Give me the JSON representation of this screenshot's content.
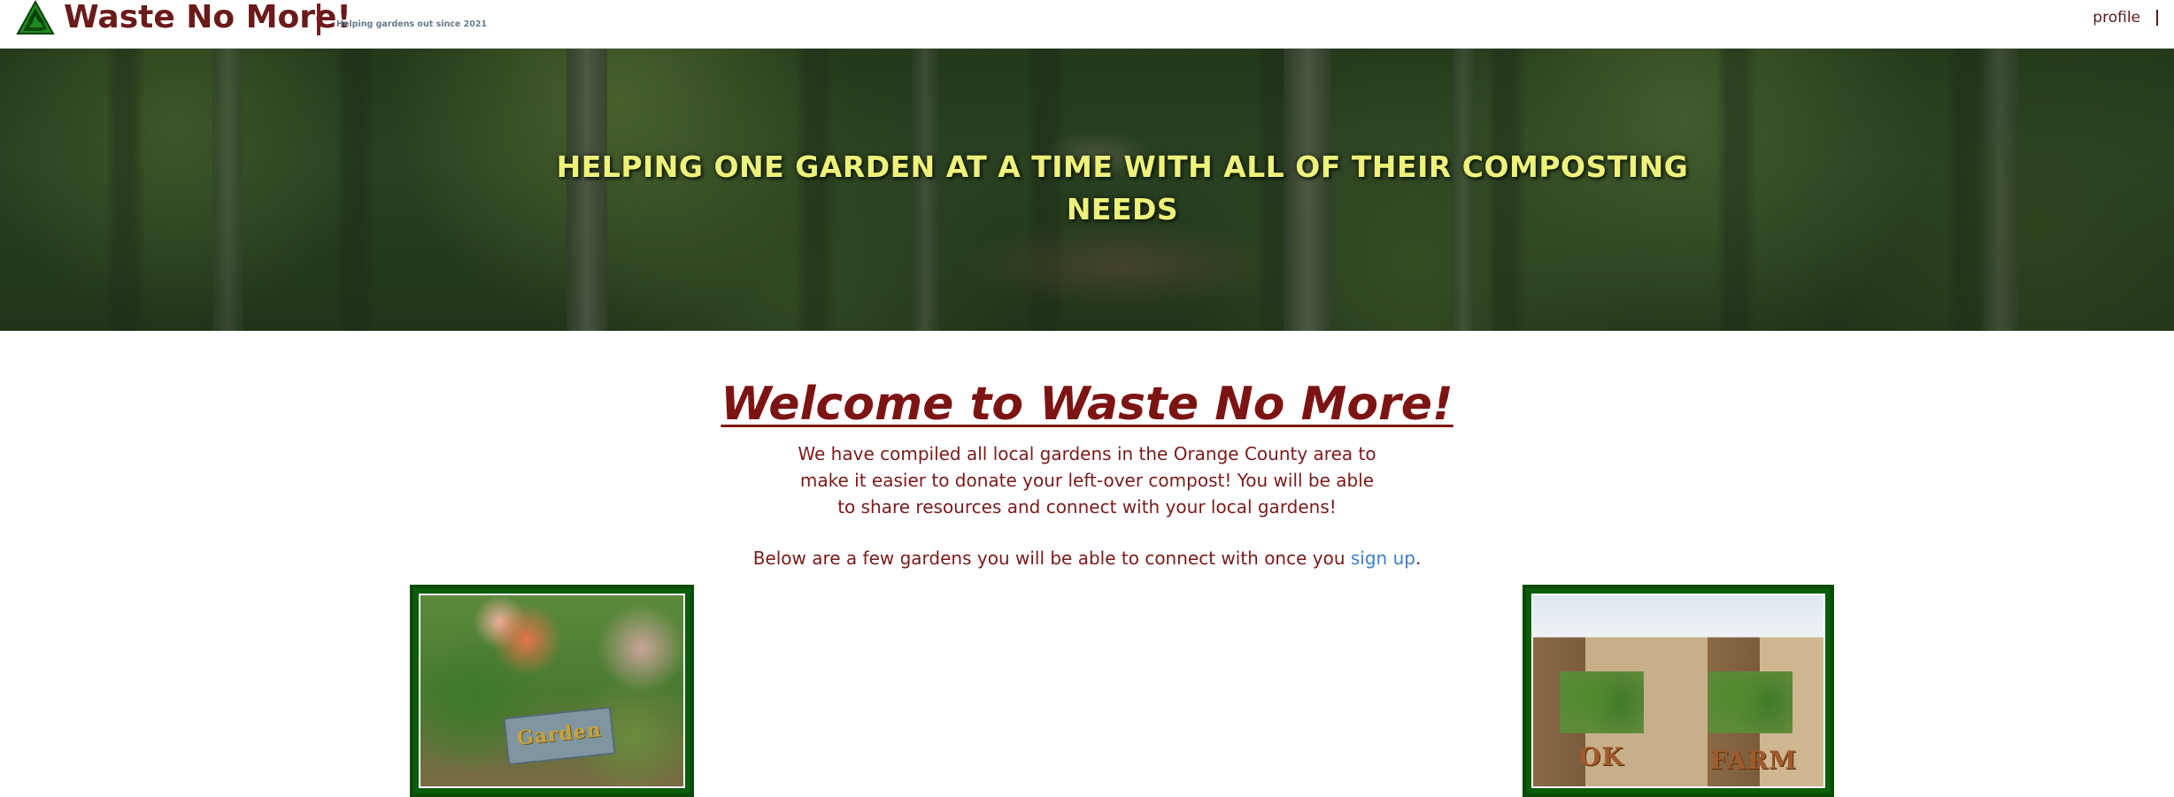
{
  "header": {
    "brand_title": "Waste No More!",
    "tagline": "Helping gardens out since 2021",
    "nav": {
      "profile_label": "profile"
    }
  },
  "hero": {
    "heading": "HELPING ONE GARDEN AT A TIME WITH ALL OF THEIR COMPOSTING NEEDS"
  },
  "main": {
    "welcome_title": "Welcome to Waste No More!",
    "intro": "We have compiled all local gardens in the Orange County area to make it easier to donate your left-over compost! You will be able to share resources and connect with your local gardens!",
    "below_prefix": "Below are a few gardens you will be able to connect with once you ",
    "signup_link": "sign up",
    "below_suffix": ".",
    "photos": [
      {
        "sign_text": "Garden"
      },
      {
        "sign_left": "OK",
        "sign_right": "FARM"
      }
    ]
  },
  "colors": {
    "brand": "#6b1a1a",
    "heading_yellow": "#eef27a",
    "link": "#3b7fc4",
    "frame_green": "#0a5d0a"
  },
  "icons": {
    "logo": "recycle-icon"
  }
}
